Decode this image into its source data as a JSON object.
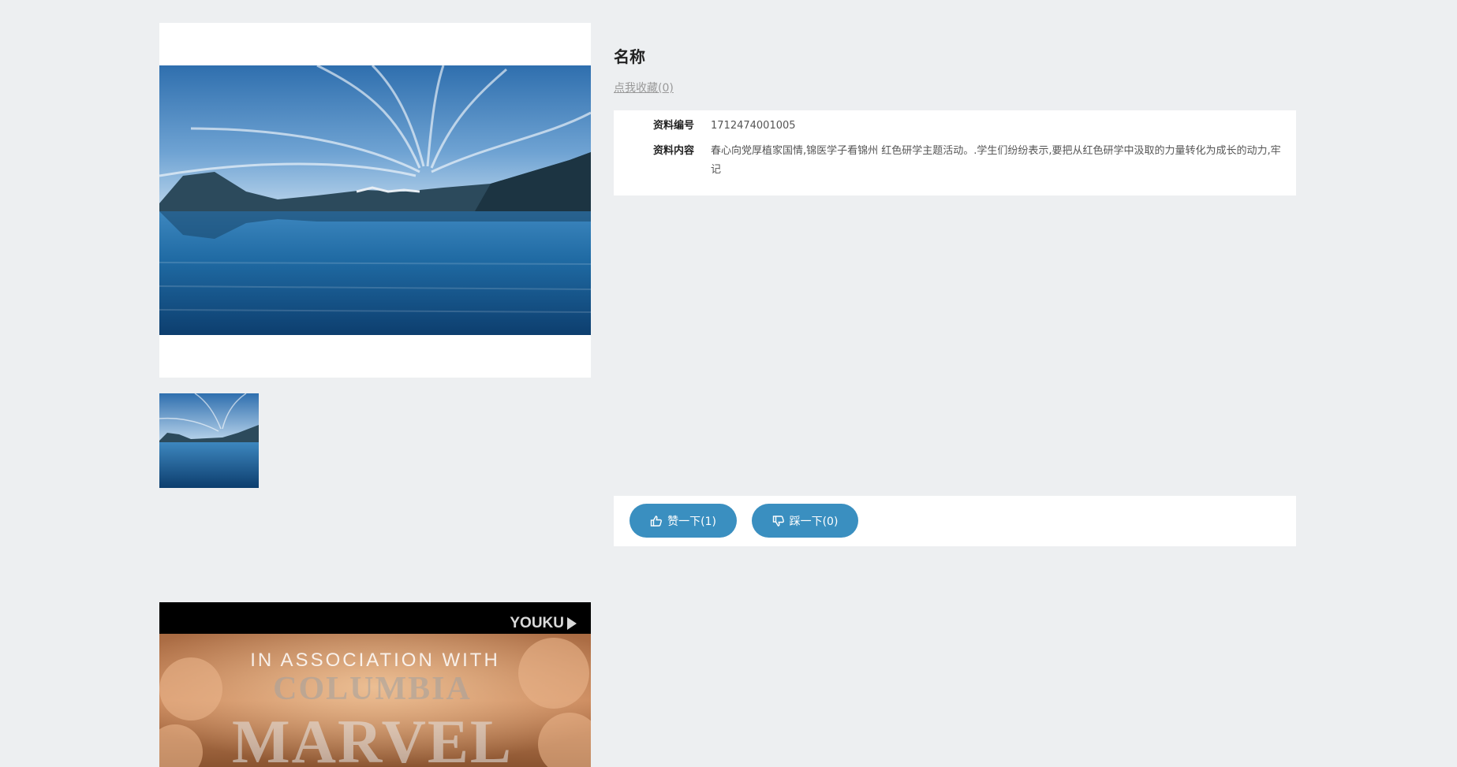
{
  "item": {
    "title": "名称",
    "favorite_label": "点我收藏(0)"
  },
  "info": {
    "rows": [
      {
        "label": "资料编号",
        "value": "1712474001005"
      },
      {
        "label": "资料内容",
        "value": "春心向党厚植家国情,锦医学子看锦州 红色研学主题活动。.学生们纷纷表示,要把从红色研学中汲取的力量转化为成长的动力,牢记"
      }
    ]
  },
  "votes": {
    "like_label": "赞一下(1)",
    "dislike_label": "踩一下(0)"
  },
  "video": {
    "brand_logo": "YOUKU",
    "caption": "IN ASSOCIATION WITH",
    "studio_top": "COLUMBIA",
    "studio_main": "MARVEL"
  },
  "colors": {
    "page_bg": "#edeff1",
    "accent": "#3a8fc0"
  },
  "icons": {
    "like": "thumbs-up-icon",
    "dislike": "thumbs-down-icon",
    "video_logo": "youku-arrow-icon"
  }
}
